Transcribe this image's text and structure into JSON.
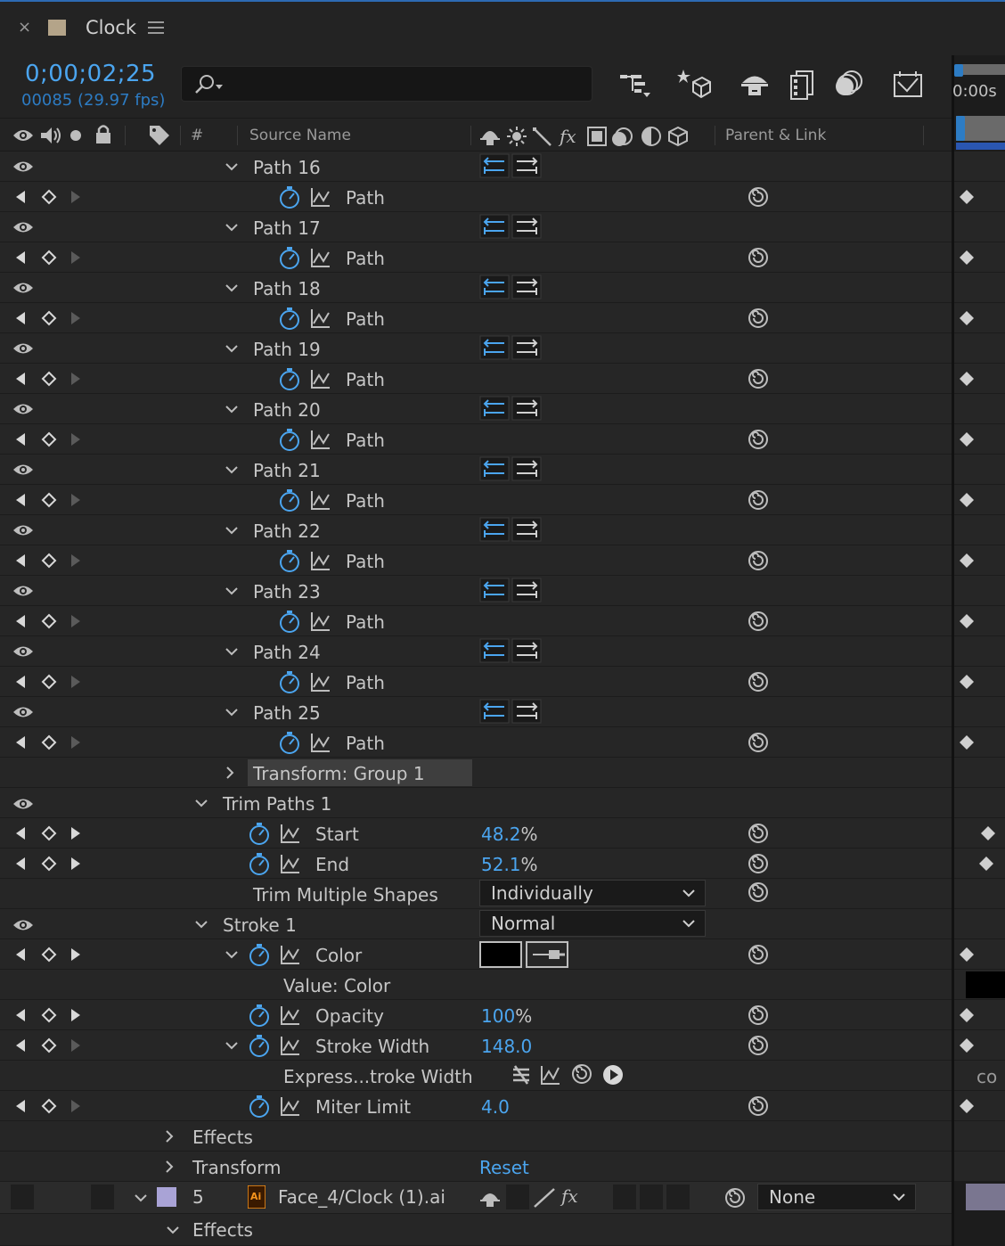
{
  "panel": {
    "close": "×",
    "title": "Clock",
    "swatch": "#b4a489"
  },
  "timecode": "0;00;02;25",
  "frames": "00085 (29.97 fps)",
  "search": {
    "placeholder": ""
  },
  "columns": {
    "hash": "#",
    "source": "Source Name",
    "parent": "Parent & Link"
  },
  "timeline": {
    "start": "0:00s",
    "cut_text": "co"
  },
  "paths": [
    {
      "group": "Path 16",
      "prop": "Path"
    },
    {
      "group": "Path 17",
      "prop": "Path"
    },
    {
      "group": "Path 18",
      "prop": "Path"
    },
    {
      "group": "Path 19",
      "prop": "Path"
    },
    {
      "group": "Path 20",
      "prop": "Path"
    },
    {
      "group": "Path 21",
      "prop": "Path"
    },
    {
      "group": "Path 22",
      "prop": "Path"
    },
    {
      "group": "Path 23",
      "prop": "Path"
    },
    {
      "group": "Path 24",
      "prop": "Path"
    },
    {
      "group": "Path 25",
      "prop": "Path"
    }
  ],
  "transform_group": "Transform: Group 1",
  "trim": {
    "title": "Trim Paths 1",
    "start_label": "Start",
    "start_value": "48.2",
    "start_unit": "%",
    "end_label": "End",
    "end_value": "52.1",
    "end_unit": "%",
    "multiple_label": "Trim Multiple Shapes",
    "multiple_value": "Individually"
  },
  "stroke": {
    "title": "Stroke 1",
    "blend": "Normal",
    "color_label": "Color",
    "color_value": "#000000",
    "value_label": "Value: Color",
    "opacity_label": "Opacity",
    "opacity_value": "100",
    "opacity_unit": "%",
    "width_label": "Stroke Width",
    "width_value": "148.0",
    "expr_label": "Express...troke Width",
    "miter_label": "Miter Limit",
    "miter_value": "4.0"
  },
  "effects_label": "Effects",
  "transform_label": "Transform",
  "transform_reset": "Reset",
  "layer": {
    "number": "5",
    "name": "Face_4/Clock (1).ai",
    "parent": "None",
    "label_color": "#a9a3d6"
  },
  "layer_effects": "Effects",
  "colors": {
    "accent": "#4ba5ef",
    "bg": "#232323",
    "row": "#262626"
  }
}
